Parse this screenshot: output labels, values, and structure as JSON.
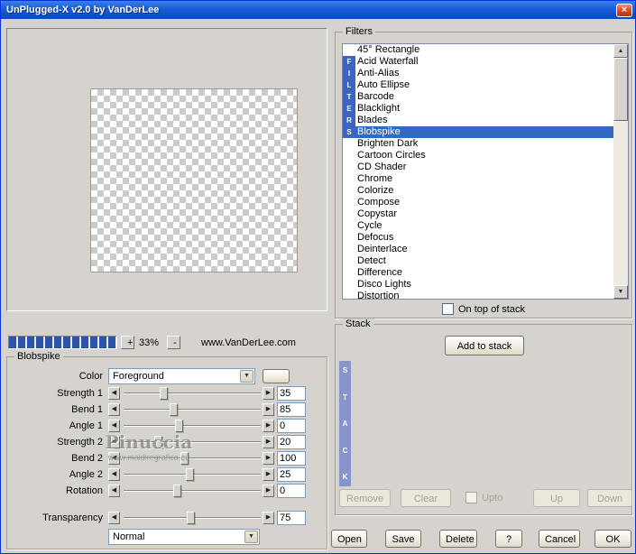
{
  "window": {
    "title": "UnPlugged-X v2.0 by VanDerLee",
    "close_label": "×"
  },
  "zoom": {
    "zoom_in": "+",
    "level": "33%",
    "zoom_out": "-",
    "website": "www.VanDerLee.com"
  },
  "filters": {
    "group_label": "Filters",
    "vertical_label": "FILTERS",
    "selected": "Blobspike",
    "items": [
      "45° Rectangle",
      "Acid Waterfall",
      "Anti-Alias",
      "Auto Ellipse",
      "Barcode",
      "Blacklight",
      "Blades",
      "Blobspike",
      "Brighten Dark",
      "Cartoon Circles",
      "CD Shader",
      "Chrome",
      "Colorize",
      "Compose",
      "Copystar",
      "Cycle",
      "Defocus",
      "Deinterlace",
      "Detect",
      "Difference",
      "Disco Lights",
      "Distortion"
    ],
    "scroll_up": "▲",
    "scroll_down": "▼",
    "on_top_label": "On top of stack",
    "on_top_checked": false
  },
  "stack": {
    "group_label": "Stack",
    "add_button": "Add to stack",
    "vertical_label": "STACK",
    "remove_button": "Remove",
    "clear_button": "Clear",
    "upto_label": "Upto",
    "upto_checked": false,
    "up_button": "Up",
    "down_button": "Down"
  },
  "params": {
    "group_label": "Blobspike",
    "color_label": "Color",
    "color_value": "Foreground",
    "combo_arrow": "▼",
    "decrement_glyph": "◀",
    "increment_glyph": "▶",
    "sliders": [
      {
        "label": "Strength 1",
        "value": "35",
        "pos": 29
      },
      {
        "label": "Bend 1",
        "value": "85",
        "pos": 36
      },
      {
        "label": "Angle 1",
        "value": "0",
        "pos": 40
      },
      {
        "label": "Strength 2",
        "value": "20",
        "pos": 25
      },
      {
        "label": "Bend 2",
        "value": "100",
        "pos": 44
      },
      {
        "label": "Angle 2",
        "value": "25",
        "pos": 48
      },
      {
        "label": "Rotation",
        "value": "0",
        "pos": 39
      }
    ],
    "transparency": {
      "label": "Transparency",
      "value": "75",
      "pos": 49
    },
    "blend_value": "Normal",
    "watermark_line1": "Pinuccia",
    "watermark_line2": "www.maidiregrafica.eu"
  },
  "footer": {
    "open": "Open",
    "save": "Save",
    "delete": "Delete",
    "help": "?",
    "cancel": "Cancel",
    "ok": "OK"
  },
  "colors": {
    "title_gradient_top": "#3A80E8",
    "title_gradient_bottom": "#0A46C0",
    "selection_blue": "#316AC5",
    "filters_strip_blue": "#3C64C0",
    "stack_strip_blue": "#8795CC",
    "progress_segment_blue": "#2B55A8",
    "dialog_background": "#D6D3CE"
  }
}
